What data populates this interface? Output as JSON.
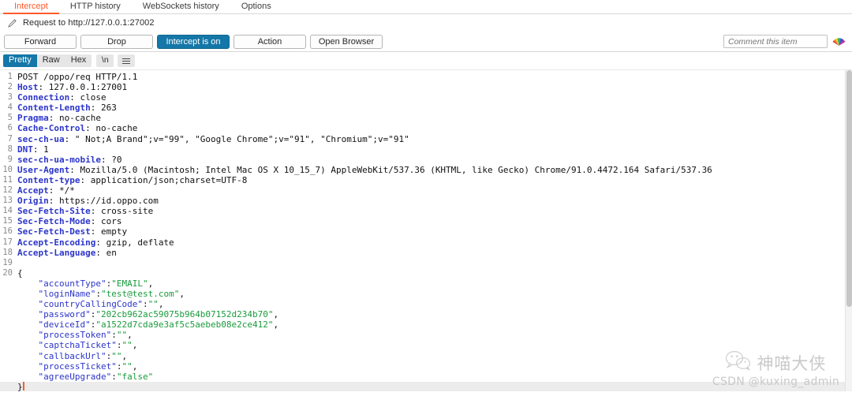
{
  "tabs": [
    {
      "label": "Intercept",
      "active": true
    },
    {
      "label": "HTTP history",
      "active": false
    },
    {
      "label": "WebSockets history",
      "active": false
    },
    {
      "label": "Options",
      "active": false
    }
  ],
  "title": {
    "icon": "pencil-icon",
    "text": "Request to http://127.0.0.1:27002"
  },
  "actions": {
    "forward": "Forward",
    "drop": "Drop",
    "intercept": "Intercept is on",
    "action": "Action",
    "open_browser": "Open Browser"
  },
  "comment": {
    "value": "",
    "placeholder": "Comment this item",
    "icon": "color-fan-icon"
  },
  "viewer": {
    "pretty": "Pretty",
    "raw": "Raw",
    "hex": "Hex",
    "newline": "\\n",
    "menu_icon": "hamburger-menu-icon"
  },
  "colors": {
    "accent_tab": "#ff5a2b",
    "accent_button": "#1477a8",
    "header_key": "#2c35c9",
    "string_value": "#1a9b3c",
    "caret": "#ff5a2b"
  },
  "message": {
    "lines": [
      {
        "n": 1,
        "segs": [
          {
            "t": "POST /oppo/req HTTP/1.1",
            "c": "plain"
          }
        ]
      },
      {
        "n": 2,
        "segs": [
          {
            "t": "Host",
            "c": "hdr"
          },
          {
            "t": ": 127.0.0.1:27001",
            "c": "plain"
          }
        ]
      },
      {
        "n": 3,
        "segs": [
          {
            "t": "Connection",
            "c": "hdr"
          },
          {
            "t": ": close",
            "c": "plain"
          }
        ]
      },
      {
        "n": 4,
        "segs": [
          {
            "t": "Content-Length",
            "c": "hdr"
          },
          {
            "t": ": 263",
            "c": "plain"
          }
        ]
      },
      {
        "n": 5,
        "segs": [
          {
            "t": "Pragma",
            "c": "hdr"
          },
          {
            "t": ": no-cache",
            "c": "plain"
          }
        ]
      },
      {
        "n": 6,
        "segs": [
          {
            "t": "Cache-Control",
            "c": "hdr"
          },
          {
            "t": ": no-cache",
            "c": "plain"
          }
        ]
      },
      {
        "n": 7,
        "segs": [
          {
            "t": "sec-ch-ua",
            "c": "hdr"
          },
          {
            "t": ": \" Not;A Brand\";v=\"99\", \"Google Chrome\";v=\"91\", \"Chromium\";v=\"91\"",
            "c": "plain"
          }
        ]
      },
      {
        "n": 8,
        "segs": [
          {
            "t": "DNT",
            "c": "hdr"
          },
          {
            "t": ": 1",
            "c": "plain"
          }
        ]
      },
      {
        "n": 9,
        "segs": [
          {
            "t": "sec-ch-ua-mobile",
            "c": "hdr"
          },
          {
            "t": ": ?0",
            "c": "plain"
          }
        ]
      },
      {
        "n": 10,
        "segs": [
          {
            "t": "User-Agent",
            "c": "hdr"
          },
          {
            "t": ": Mozilla/5.0 (Macintosh; Intel Mac OS X 10_15_7) AppleWebKit/537.36 (KHTML, like Gecko) Chrome/91.0.4472.164 Safari/537.36",
            "c": "plain"
          }
        ]
      },
      {
        "n": 11,
        "segs": [
          {
            "t": "Content-type",
            "c": "hdr"
          },
          {
            "t": ": application/json;charset=UTF-8",
            "c": "plain"
          }
        ]
      },
      {
        "n": 12,
        "segs": [
          {
            "t": "Accept",
            "c": "hdr"
          },
          {
            "t": ": */*",
            "c": "plain"
          }
        ]
      },
      {
        "n": 13,
        "segs": [
          {
            "t": "Origin",
            "c": "hdr"
          },
          {
            "t": ": https://id.oppo.com",
            "c": "plain"
          }
        ]
      },
      {
        "n": 14,
        "segs": [
          {
            "t": "Sec-Fetch-Site",
            "c": "hdr"
          },
          {
            "t": ": cross-site",
            "c": "plain"
          }
        ]
      },
      {
        "n": 15,
        "segs": [
          {
            "t": "Sec-Fetch-Mode",
            "c": "hdr"
          },
          {
            "t": ": cors",
            "c": "plain"
          }
        ]
      },
      {
        "n": 16,
        "segs": [
          {
            "t": "Sec-Fetch-Dest",
            "c": "hdr"
          },
          {
            "t": ": empty",
            "c": "plain"
          }
        ]
      },
      {
        "n": 17,
        "segs": [
          {
            "t": "Accept-Encoding",
            "c": "hdr"
          },
          {
            "t": ": gzip, deflate",
            "c": "plain"
          }
        ]
      },
      {
        "n": 18,
        "segs": [
          {
            "t": "Accept-Language",
            "c": "hdr"
          },
          {
            "t": ": en",
            "c": "plain"
          }
        ]
      },
      {
        "n": 19,
        "segs": []
      },
      {
        "n": 20,
        "segs": [
          {
            "t": "{",
            "c": "plain"
          }
        ]
      },
      {
        "n": "",
        "segs": [
          {
            "t": "    ",
            "c": "plain"
          },
          {
            "t": "\"accountType\"",
            "c": "key"
          },
          {
            "t": ":",
            "c": "plain"
          },
          {
            "t": "\"EMAIL\"",
            "c": "str"
          },
          {
            "t": ",",
            "c": "plain"
          }
        ]
      },
      {
        "n": "",
        "segs": [
          {
            "t": "    ",
            "c": "plain"
          },
          {
            "t": "\"loginName\"",
            "c": "key"
          },
          {
            "t": ":",
            "c": "plain"
          },
          {
            "t": "\"test@test.com\"",
            "c": "str"
          },
          {
            "t": ",",
            "c": "plain"
          }
        ]
      },
      {
        "n": "",
        "segs": [
          {
            "t": "    ",
            "c": "plain"
          },
          {
            "t": "\"countryCallingCode\"",
            "c": "key"
          },
          {
            "t": ":",
            "c": "plain"
          },
          {
            "t": "\"\"",
            "c": "str"
          },
          {
            "t": ",",
            "c": "plain"
          }
        ]
      },
      {
        "n": "",
        "segs": [
          {
            "t": "    ",
            "c": "plain"
          },
          {
            "t": "\"password\"",
            "c": "key"
          },
          {
            "t": ":",
            "c": "plain"
          },
          {
            "t": "\"202cb962ac59075b964b07152d234b70\"",
            "c": "str"
          },
          {
            "t": ",",
            "c": "plain"
          }
        ]
      },
      {
        "n": "",
        "segs": [
          {
            "t": "    ",
            "c": "plain"
          },
          {
            "t": "\"deviceId\"",
            "c": "key"
          },
          {
            "t": ":",
            "c": "plain"
          },
          {
            "t": "\"a1522d7cda9e3af5c5aebeb08e2ce412\"",
            "c": "str"
          },
          {
            "t": ",",
            "c": "plain"
          }
        ]
      },
      {
        "n": "",
        "segs": [
          {
            "t": "    ",
            "c": "plain"
          },
          {
            "t": "\"processToken\"",
            "c": "key"
          },
          {
            "t": ":",
            "c": "plain"
          },
          {
            "t": "\"\"",
            "c": "str"
          },
          {
            "t": ",",
            "c": "plain"
          }
        ]
      },
      {
        "n": "",
        "segs": [
          {
            "t": "    ",
            "c": "plain"
          },
          {
            "t": "\"captchaTicket\"",
            "c": "key"
          },
          {
            "t": ":",
            "c": "plain"
          },
          {
            "t": "\"\"",
            "c": "str"
          },
          {
            "t": ",",
            "c": "plain"
          }
        ]
      },
      {
        "n": "",
        "segs": [
          {
            "t": "    ",
            "c": "plain"
          },
          {
            "t": "\"callbackUrl\"",
            "c": "key"
          },
          {
            "t": ":",
            "c": "plain"
          },
          {
            "t": "\"\"",
            "c": "str"
          },
          {
            "t": ",",
            "c": "plain"
          }
        ]
      },
      {
        "n": "",
        "segs": [
          {
            "t": "    ",
            "c": "plain"
          },
          {
            "t": "\"processTicket\"",
            "c": "key"
          },
          {
            "t": ":",
            "c": "plain"
          },
          {
            "t": "\"\"",
            "c": "str"
          },
          {
            "t": ",",
            "c": "plain"
          }
        ]
      },
      {
        "n": "",
        "segs": [
          {
            "t": "    ",
            "c": "plain"
          },
          {
            "t": "\"agreeUpgrade\"",
            "c": "key"
          },
          {
            "t": ":",
            "c": "plain"
          },
          {
            "t": "\"false\"",
            "c": "str"
          }
        ]
      },
      {
        "n": "",
        "segs": [
          {
            "t": "}",
            "c": "plain"
          }
        ],
        "current": true,
        "caret": true
      }
    ]
  },
  "watermark": {
    "icon": "wechat-icon",
    "name": "神喵大侠",
    "sub": "CSDN @kuxing_admin"
  }
}
